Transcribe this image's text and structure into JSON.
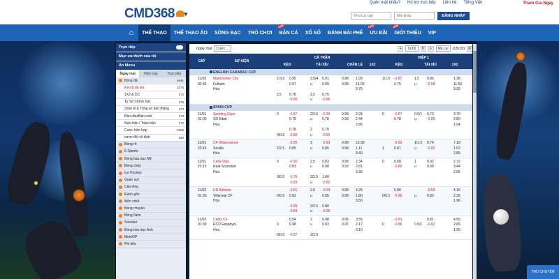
{
  "brand": {
    "logo": "CMD368",
    "accent": "#1e64b7"
  },
  "toplinks": [
    "Quên mật khẩu?",
    "Hỗ trợ trực tiếp",
    "Liên hệ",
    "Tiếng Việt"
  ],
  "join": "Tham Gia Ngay",
  "login": {
    "user_placeholder": "Tên truy cập",
    "pass_placeholder": "Mật khẩu",
    "button": "ĐĂNG NHẬP"
  },
  "nav": [
    "THỂ THAO",
    "THỂ THAO ẢO",
    "SÒNG BẠC",
    "TRÒ CHƠI",
    "BẮN CÁ",
    "XỔ SỐ",
    "ĐÁNH BÀI PHÊ",
    "ƯU ĐÃI",
    "GIỚI THIỆU",
    "VIP"
  ],
  "sidebar": {
    "live": "Trực tiếp",
    "fav": "Mục ưa thích của tôi",
    "menu": "Ẩn Menu",
    "tabs": [
      "Ngày mai",
      "Hôm nay",
      "Trực tiếp"
    ],
    "items": [
      {
        "label": "Bóng đá",
        "count": "4841",
        "type": "sport"
      },
      {
        "label": "Kèo & tài xỉu",
        "count": "3375",
        "type": "sub hl"
      },
      {
        "label": "1X2 & DC",
        "count": "173",
        "type": "sub"
      },
      {
        "label": "Tỷ Số Chính Xác",
        "count": "179",
        "type": "sub"
      },
      {
        "label": "chẵn lẻ & Tổng số bàn thắng",
        "count": "173",
        "type": "sub"
      },
      {
        "label": "Bàn đầu/Bàn cuối",
        "count": "173",
        "type": "sub"
      },
      {
        "label": "Nửa trận / Toàn trận",
        "count": "173",
        "type": "sub"
      },
      {
        "label": "Cược hỗn hợp",
        "count": "2969",
        "type": "sub"
      },
      {
        "label": "cược đối vô địch",
        "count": "159",
        "type": "sub"
      },
      {
        "label": "Bóng rổ",
        "count": "",
        "type": "sport"
      },
      {
        "label": "E-Sports",
        "count": "",
        "type": "sport"
      },
      {
        "label": "Bóng bầu dục Mỹ",
        "count": "",
        "type": "sport"
      },
      {
        "label": "Bóng chày",
        "count": "",
        "type": "sport"
      },
      {
        "label": "Ice Hockey",
        "count": "",
        "type": "sport"
      },
      {
        "label": "Quần vợt",
        "count": "",
        "type": "sport"
      },
      {
        "label": "Cầu lông",
        "count": "",
        "type": "sport"
      },
      {
        "label": "Đánh gôn",
        "count": "",
        "type": "sport"
      },
      {
        "label": "Môn crikê",
        "count": "",
        "type": "sport"
      },
      {
        "label": "Bóng chuyền",
        "count": "",
        "type": "sport"
      },
      {
        "label": "Bóng Ném",
        "count": "",
        "type": "sport"
      },
      {
        "label": "Snooker",
        "count": "",
        "type": "sport"
      },
      {
        "label": "Bóng bầu dục Anh",
        "count": "",
        "type": "sport"
      },
      {
        "label": "MotoGP",
        "count": "",
        "type": "sport"
      },
      {
        "label": "Phi tiêu",
        "count": "",
        "type": "sport"
      }
    ]
  },
  "filter": {
    "day": "ngày mai",
    "odds": "Cược ...",
    "date": "11/02",
    "odds_type": "Mã Lai",
    "pages": "(15/15)"
  },
  "header": {
    "time": "GIỜ",
    "event": "SỰ KIỆN",
    "full": "CẢ TRẬN",
    "half": "HIỆP 1",
    "keo": "KÈO",
    "taixiu": "TÀI XỈU",
    "chanle": "CHẴN LẺ",
    "x12": "1X2"
  },
  "leagues": [
    {
      "name": "ENGLISH CARABAO CUP",
      "matches": [
        {
          "date": "11/02",
          "time": "03:45",
          "home": "Manchester City",
          "away": "Fulham",
          "draw": "Hòa",
          "lines": [
            [
              "2.5/3",
              "0.95",
              "3.5/4",
              "0.91",
              "0.98",
              "1.09",
              "1/1.5",
              "-0.87",
              "1.5",
              "0.86",
              "1.38"
            ],
            [
              "",
              "0.97",
              "u",
              "0.99",
              "0.98",
              "16.00",
              "",
              "0.75",
              "u",
              "-0.98",
              "11.50"
            ],
            [
              "",
              "",
              "",
              "",
              "",
              "9.75",
              "",
              "",
              "",
              "",
              "3.25"
            ],
            [
              "2.5",
              "0.78",
              "3.5",
              "0.75",
              "",
              "",
              "",
              "",
              "",
              "",
              ""
            ],
            [
              "",
              "-0.86",
              "u",
              "-0.86",
              "",
              "",
              "",
              "",
              "",
              "",
              ""
            ]
          ]
        }
      ]
    },
    {
      "name": "SPAIN CUP",
      "matches": [
        {
          "date": "11/01",
          "time": "01:00",
          "home": "Sporting Gijon",
          "away": "SD Eibar",
          "draw": "Hòa",
          "lines": [
            [
              "0",
              "-0.87",
              "2/2.5",
              "-0.90",
              "0.98",
              "2.93",
              "0",
              "-0.87",
              "0.5/1",
              "0.73",
              "3.70"
            ],
            [
              "",
              "0.78",
              "u",
              "0.78",
              "0.93",
              "2.44",
              "",
              "0.78",
              "u",
              "-0.85",
              "3.80"
            ],
            [
              "",
              "",
              "",
              "",
              "",
              "2.85",
              "",
              "",
              "",
              "",
              "1.94"
            ],
            [
              "",
              "0.78",
              "2",
              "0.79",
              "",
              "",
              "",
              "",
              "",
              "",
              ""
            ],
            [
              "0/0.5",
              "-0.88",
              "u",
              "-0.92",
              "",
              "",
              "",
              "",
              "",
              "",
              ""
            ]
          ]
        },
        {
          "date": "11/01",
          "time": "23:15",
          "home": "CF Villanovense",
          "away": "Sevilla",
          "draw": "Hòa",
          "lines": [
            [
              "",
              "-0.95",
              "3",
              "-0.93",
              "0.98",
              "13.00",
              "",
              "-0.93",
              "1/1.5",
              "0.74",
              "7.19"
            ],
            [
              "2/2.5",
              "0.85",
              "u",
              "0.85",
              "0.98",
              "1.11",
              "1",
              "0.81",
              "u",
              "-0.92",
              "1.52"
            ],
            [
              "",
              "",
              "",
              "",
              "",
              "8.40",
              "",
              "",
              "",
              "",
              "2.85"
            ]
          ]
        },
        {
          "date": "11/01",
          "time": "23:15",
          "home": "Celta Vigo",
          "away": "Real Sociedad",
          "draw": "Hòa",
          "lines": [
            [
              "0",
              "-0.90",
              "2.5",
              "0.83",
              "0.98",
              "2.34",
              "0",
              "0.68",
              "1",
              "0.92",
              "2.72"
            ],
            [
              "",
              "0.83",
              "u",
              "0.98",
              "0.93",
              "2.81",
              "",
              "-0.80",
              "u",
              "0.90",
              "3.44"
            ],
            [
              "",
              "",
              "",
              "",
              "",
              "3.30",
              "",
              "",
              "",
              "",
              "2.05"
            ],
            [
              "0/0.5",
              "-0.75",
              "2/2.5",
              "1.00",
              "",
              "",
              "",
              "",
              "",
              "",
              ""
            ],
            [
              "",
              "-0.83",
              "u",
              "-0.82",
              "",
              "",
              "",
              "",
              "",
              "",
              ""
            ]
          ]
        },
        {
          "date": "11/02",
          "time": "01:30",
          "home": "UD Almeria",
          "away": "Villarreal CF",
          "draw": "Hòa",
          "lines": [
            [
              "",
              "-0.81",
              "2.5",
              "-0.93",
              "0.98",
              "4.25",
              "",
              "0.88",
              "",
              "-0.55",
              "4.15"
            ],
            [
              "0/0.5",
              "0.82",
              "u",
              "0.85",
              "0.98",
              "1.80",
              "0/0.5",
              "-0.90",
              "u",
              "0.82",
              "2.36"
            ],
            [
              "",
              "",
              "",
              "",
              "",
              "3.50",
              "",
              "",
              "",
              "",
              "1.96"
            ],
            [
              "",
              "-0.89",
              "2/2.5",
              "0.80",
              "",
              "",
              "",
              "",
              "",
              "",
              ""
            ],
            [
              "",
              "-0.83",
              "u",
              "-0.90",
              "",
              "",
              "",
              "",
              "",
              "",
              ""
            ]
          ]
        },
        {
          "date": "11/02",
          "time": "01:30",
          "home": "Cadiz CF",
          "away": "RCD Espanyol",
          "draw": "Hòa",
          "lines": [
            [
              "",
              "0.94",
              "2",
              "0.98",
              "0.95",
              "3.55",
              "",
              "-0.81",
              "",
              "0.81",
              "4.50"
            ],
            [
              "0",
              "0.98",
              "u",
              "0.93",
              "0.97",
              "2.17",
              "0",
              "-0.86",
              "0.5/1",
              "-0.82",
              "2.65"
            ],
            [
              "",
              "",
              "",
              "",
              "",
              "3.10",
              "",
              "",
              "",
              "",
              "1.99"
            ],
            [
              "0/0.5",
              "-0.87",
              "2/2.5",
              "",
              "",
              "",
              "",
              "",
              "",
              "",
              ""
            ]
          ]
        }
      ]
    }
  ],
  "chat": "TRÒ CHUYỆN"
}
